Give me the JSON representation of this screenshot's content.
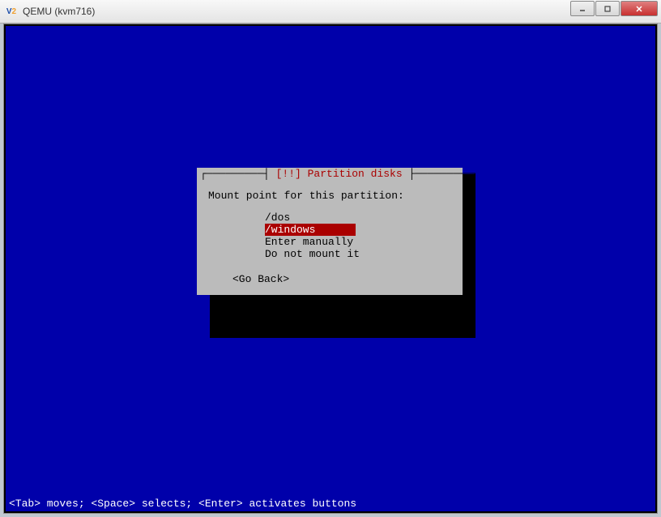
{
  "window": {
    "title": "QEMU (kvm716)",
    "icon_v": "V",
    "icon_e": "2"
  },
  "dialog": {
    "title": "[!!] Partition disks",
    "prompt": "Mount point for this partition:",
    "options": [
      {
        "label": "/dos",
        "selected": false
      },
      {
        "label": "/windows",
        "selected": true
      },
      {
        "label": "Enter manually",
        "selected": false
      },
      {
        "label": "Do not mount it",
        "selected": false
      }
    ],
    "goback": "<Go Back>"
  },
  "statusbar": "<Tab> moves; <Space> selects; <Enter> activates buttons"
}
